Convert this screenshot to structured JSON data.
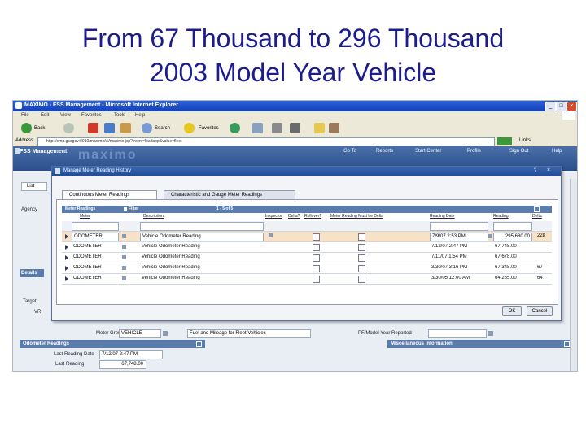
{
  "slide": {
    "title_line1": "From 67 Thousand to 296 Thousand",
    "title_line2": "2003 Model Year Vehicle"
  },
  "browser": {
    "window_title": "MAXIMO - FSS Management - Microsoft Internet Explorer",
    "menu": [
      "File",
      "Edit",
      "View",
      "Favorites",
      "Tools",
      "Help"
    ],
    "toolbar": {
      "back": "Back",
      "search": "Search",
      "favorites": "Favorites"
    },
    "address_label": "Address",
    "address_value": "http://emp.gsagov:8010/maximo/ui/maximo.jsp?event=loadapp&value=fleet",
    "links_label": "Links"
  },
  "app": {
    "title": "FSS Management",
    "watermark": "maximo",
    "nav": [
      "Go To",
      "Reports",
      "Start Center",
      "Profile",
      "Sign Out",
      "Help"
    ],
    "list_tab": "List",
    "background_labels": {
      "agency": "Agency",
      "details": "Details",
      "target": "Target",
      "vr": "VR",
      "meter_group": "Meter Group",
      "pf_model_year": "PF/Model Year Reported"
    },
    "meter_group_value": "VEHICLE",
    "meter_group_desc": "Fuel and Mileage for Fleet Vehicles",
    "odometer_section": "Odometer Readings",
    "misc_section": "Miscellaneous Information",
    "last_reading_date_label": "Last Reading Date",
    "last_reading_date_value": "7/12/07 2:47 PM",
    "last_reading_label": "Last Reading",
    "last_reading_value": "67,748.00"
  },
  "dialog": {
    "title": "Manage Meter Reading History",
    "tabs": [
      "Continuous Meter Readings",
      "Characteristic and Gauge Meter Readings"
    ],
    "table_title": "Meter Readings",
    "filter_label": "Filter",
    "pager": "1 - 5 of 5",
    "columns": [
      "Meter",
      "Description",
      "Inspector",
      "Delta?",
      "Rollover?",
      "Meter Reading Must be Delta",
      "Reading Date",
      "Reading",
      "Delta"
    ],
    "filter_meter": "",
    "rows": [
      {
        "meter": "ODOMETER",
        "desc": "Vehicle Odometer Reading",
        "date": "7/9/07 2:53 PM",
        "reading": "295,680.00",
        "delta": "228"
      },
      {
        "meter": "ODOMETER",
        "desc": "Vehicle Odometer Reading",
        "date": "7/12/07 2:47 PM",
        "reading": "67,748.00",
        "delta": ""
      },
      {
        "meter": "ODOMETER",
        "desc": "Vehicle Odometer Reading",
        "date": "7/11/07 1:54 PM",
        "reading": "67,678.00",
        "delta": ""
      },
      {
        "meter": "ODOMETER",
        "desc": "Vehicle Odometer Reading",
        "date": "3/30/07 3:16 PM",
        "reading": "67,348.00",
        "delta": "67"
      },
      {
        "meter": "ODOMETER",
        "desc": "Vehicle Odometer Reading",
        "date": "3/30/05 12:00 AM",
        "reading": "64,285.00",
        "delta": "64"
      }
    ],
    "ok_button": "OK",
    "cancel_button": "Cancel"
  }
}
